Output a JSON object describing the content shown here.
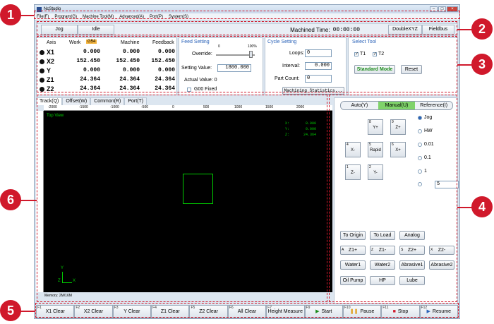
{
  "window": {
    "title": "NcStudio"
  },
  "menu": [
    "File(F)",
    "Program(G)",
    "Machine Tool(M)",
    "Advanced(A)",
    "Port(P)",
    "System(S)"
  ],
  "status": {
    "mode": "Jog",
    "state": "Idle",
    "machined_label": "Machined Time:",
    "machined_time": "00:00:00",
    "btn_double": "DoubleXYZ",
    "btn_fieldbus": "Fieldbus"
  },
  "coords": {
    "headers": {
      "axis": "Axis",
      "work": "Work",
      "badge": "G54",
      "machine": "Machine",
      "feedback": "Feedback"
    },
    "rows": [
      {
        "axis": "X1",
        "work": "0.000",
        "machine": "0.000",
        "feedback": "0.000"
      },
      {
        "axis": "X2",
        "work": "152.450",
        "machine": "152.450",
        "feedback": "152.450"
      },
      {
        "axis": "Y",
        "work": "0.000",
        "machine": "0.000",
        "feedback": "0.000"
      },
      {
        "axis": "Z1",
        "work": "24.364",
        "machine": "24.364",
        "feedback": "24.364"
      },
      {
        "axis": "Z2",
        "work": "24.364",
        "machine": "24.364",
        "feedback": "24.364"
      }
    ]
  },
  "feed": {
    "title": "Feed Setting",
    "override": "Override:",
    "min": "0",
    "max": "100%",
    "setting_label": "Setting Value:",
    "setting_value": "1800.000",
    "actual": "Actual Value: 0",
    "g00": "G00 Fixed"
  },
  "cycle": {
    "title": "Cycle Setting",
    "loops": "Loops:",
    "loops_v": "0",
    "interval": "Interval:",
    "interval_v": "0.000",
    "count": "Part Count:",
    "count_v": "0",
    "stats": "Machining Statistics..."
  },
  "tool": {
    "title": "Select Tool",
    "t1": "T1",
    "t2": "T2",
    "mode": "Standard Mode",
    "reset": "Reset"
  },
  "tabs": [
    "Track(Q)",
    "Offset(W)",
    "Common(R)",
    "Port(T)"
  ],
  "view": {
    "label": "Top View",
    "readout": [
      {
        "k": "X:",
        "v": "0.000"
      },
      {
        "k": "Y:",
        "v": "0.000"
      },
      {
        "k": "Z:",
        "v": "24.364"
      }
    ],
    "memory": "Memory: 2M/16M",
    "ticks": [
      "-2000",
      "-1500",
      "-1000",
      "-500",
      "0",
      "500",
      "1000",
      "1500",
      "2000"
    ]
  },
  "control": {
    "tabs": [
      "Auto(Y)",
      "Manual(U)",
      "Reference(I)"
    ],
    "jog": [
      {
        "n": "8",
        "t": "Y+"
      },
      {
        "n": "9",
        "t": "Z+"
      },
      {
        "n": "4",
        "t": "X-"
      },
      {
        "n": "5",
        "t": "Rapid"
      },
      {
        "n": "6",
        "t": "X+"
      },
      {
        "n": "1",
        "t": "Z-"
      },
      {
        "n": "2",
        "t": "Y-"
      }
    ],
    "steps": [
      "Jog",
      "HW",
      "0.01",
      "0.1",
      "1"
    ],
    "step_input": "5",
    "row1": [
      "To Origin",
      "To Load",
      "Analog"
    ],
    "row2": [
      "Z1+",
      "Z1-",
      "Z2+",
      "Z2-"
    ],
    "row2n": [
      "A",
      "Z",
      "S",
      "X"
    ],
    "row3": [
      "Water1",
      "Water2",
      "Abrasive1",
      "Abrasive2"
    ],
    "row4": [
      "Oil Pump",
      "HP",
      "Lube"
    ]
  },
  "fkeys": [
    {
      "fn": "F1",
      "t": "X1 Clear"
    },
    {
      "fn": "F2",
      "t": "X2 Clear"
    },
    {
      "fn": "F3",
      "t": "Y Clear"
    },
    {
      "fn": "F4",
      "t": "Z1 Clear"
    },
    {
      "fn": "F5",
      "t": "Z2 Clear"
    },
    {
      "fn": "F6",
      "t": "All Clear"
    },
    {
      "fn": "F7",
      "t": "Height Measure"
    },
    {
      "fn": "F9",
      "t": "Start"
    },
    {
      "fn": "F10",
      "t": "Pause"
    },
    {
      "fn": "F11",
      "t": "Stop"
    },
    {
      "fn": "F12",
      "t": "Resume"
    }
  ],
  "callouts": [
    "1",
    "2",
    "3",
    "4",
    "5",
    "6"
  ],
  "colors": {
    "accent": "#d0192b",
    "mode_green": "#1a8a1a",
    "track_green": "#00cc00"
  }
}
